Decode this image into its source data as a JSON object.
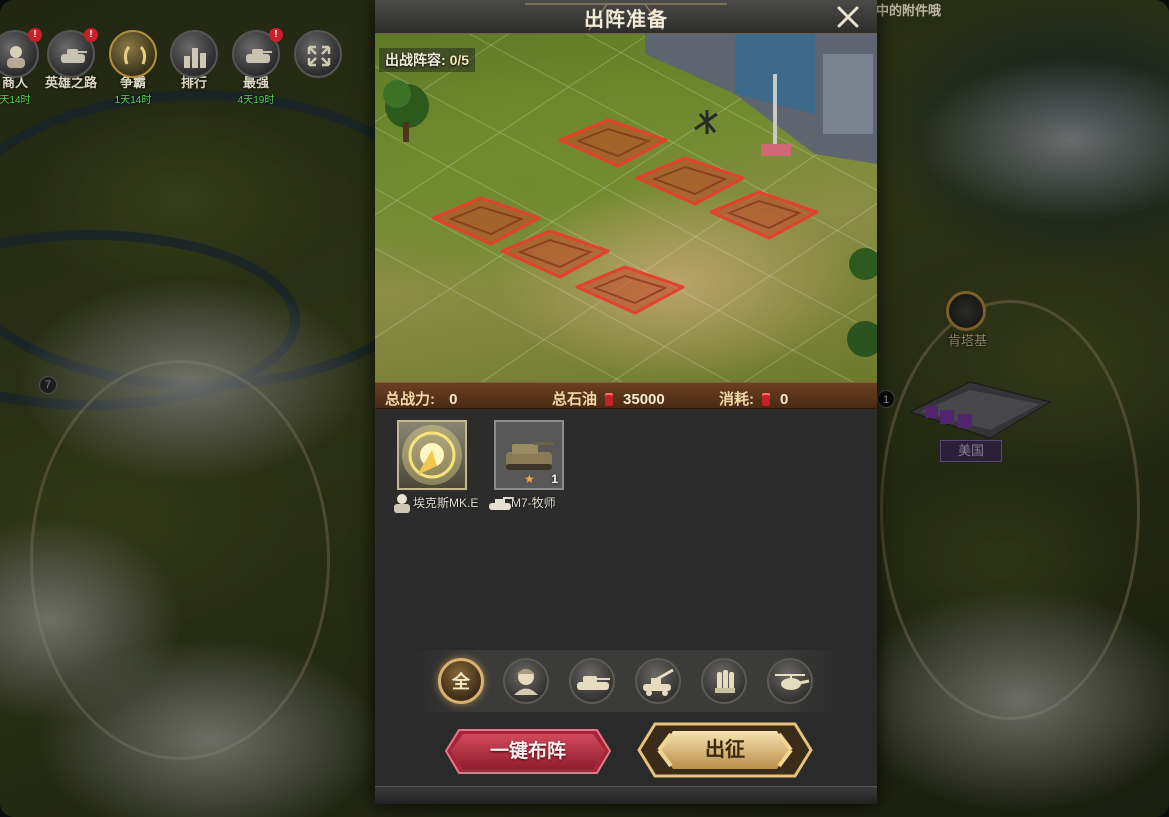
{
  "activity_bar": [
    {
      "label": "商人",
      "timer": "天14时",
      "has_badge": true,
      "icon": "merchant-icon"
    },
    {
      "label": "英雄之路",
      "timer": "",
      "has_badge": true,
      "icon": "tank-icon"
    },
    {
      "label": "争霸",
      "timer": "1天14时",
      "has_badge": false,
      "icon": "laurel-icon"
    },
    {
      "label": "排行",
      "timer": "",
      "has_badge": false,
      "icon": "ranking-icon"
    },
    {
      "label": "最强",
      "timer": "4天19时",
      "has_badge": true,
      "icon": "tank-icon"
    }
  ],
  "badge_symbol": "!",
  "top_right_text": "中的附件哦",
  "map": {
    "node_label": "肯塔基",
    "base_label": "美国",
    "base_level": "1",
    "unnamed_marker": "7"
  },
  "panel": {
    "title": "出阵准备",
    "lineup_label": "出战阵容:",
    "lineup_value": "0/5",
    "stats": {
      "power_label": "总战力:",
      "power_value": "0",
      "oil_label": "总石油",
      "oil_value": "35000",
      "cost_label": "消耗:",
      "cost_value": "0"
    },
    "units": [
      {
        "name": "埃克斯MK.E",
        "type": "hero",
        "icon": "hero-soldier-icon",
        "glow": true
      },
      {
        "name": "M7-牧师",
        "type": "artillery",
        "icon": "self-propelled-gun-icon",
        "level": "1",
        "stars": 1
      }
    ],
    "filters": [
      {
        "label": "全",
        "icon": "all-icon",
        "active": true
      },
      {
        "label": "",
        "icon": "soldier-icon",
        "active": false
      },
      {
        "label": "",
        "icon": "tank-icon",
        "active": false
      },
      {
        "label": "",
        "icon": "artillery-icon",
        "active": false
      },
      {
        "label": "",
        "icon": "missile-icon",
        "active": false
      },
      {
        "label": "",
        "icon": "helicopter-icon",
        "active": false
      }
    ],
    "buttons": {
      "auto_deploy": "一键布阵",
      "deploy": "出征"
    }
  },
  "colors": {
    "slot_red": "#d0342a",
    "stats_bar": "#5a3519",
    "button_red": "#b3283a",
    "button_gold": "#d8b46a"
  }
}
